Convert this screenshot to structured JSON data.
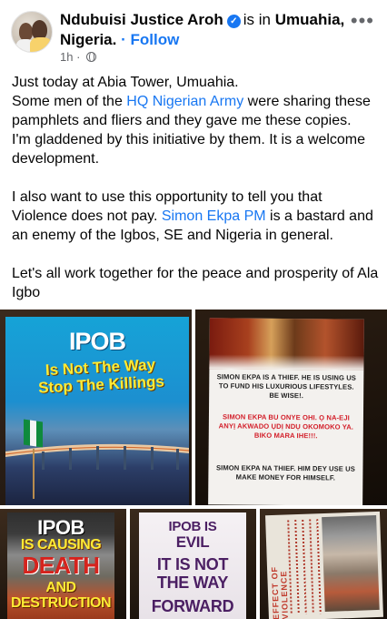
{
  "post": {
    "author": "Ndubuisi Justice Aroh",
    "is_in": "is in",
    "location": "Umuahia, Nigeria.",
    "dot": "·",
    "follow_label": "Follow",
    "time": "1h",
    "time_sep": "·",
    "more_icon": "more-horizontal-icon",
    "privacy_icon": "globe-icon",
    "verified_icon": "verified-badge-icon"
  },
  "body": {
    "p1_line1": "Just today at Abia Tower, Umuahia.",
    "p1_pre": "Some men of the ",
    "p1_link": "HQ Nigerian Army",
    "p1_post": " were sharing these pamphlets and fliers and they gave me these copies.",
    "p1_line3": "I'm gladdened by this initiative by them. It is a welcome development.",
    "p2_pre": "I also want to use this opportunity to tell you that Violence does not pay. ",
    "p2_link": "Simon Ekpa PM",
    "p2_post": " is a bastard and an enemy of the Igbos, SE and Nigeria in general.",
    "p3": "Let's all work together for the peace and prosperity of Ala Igbo"
  },
  "photos": {
    "photo1": {
      "title": "IPOB",
      "subtitle_line1": "Is Not The Way",
      "subtitle_line2": "Stop The Killings"
    },
    "photo2": {
      "block1": "SIMON EKPA IS A THIEF. HE IS USING US TO FUND HIS LUXURIOUS LIFESTYLES. BE WISE!.",
      "block2": "SIMON EKPA BU ONYE OHI. Ọ NA-EJI ANYỊ AKWADO ỤDỊ NDỤ OKOMOKO YA. BIKO MARA IHE!!!.",
      "block3": "SIMON EKPA NA THIEF. HIM DEY USE US MAKE MONEY FOR HIMSELF."
    },
    "photo3": {
      "l1": "IPOB",
      "l2": "IS CAUSING",
      "l3": "DEATH",
      "l4": "AND",
      "l5": "DESTRUCTION"
    },
    "photo4": {
      "l1": "IPOB IS",
      "l2": "EVIL",
      "l3": "IT IS NOT",
      "l4": "THE WAY",
      "l5": "FORWARD"
    },
    "photo5": {
      "vertical_title": "EFFECT OF VIOLENCE"
    }
  },
  "colors": {
    "link": "#1877f2",
    "meta": "#65676b",
    "text": "#050505"
  }
}
